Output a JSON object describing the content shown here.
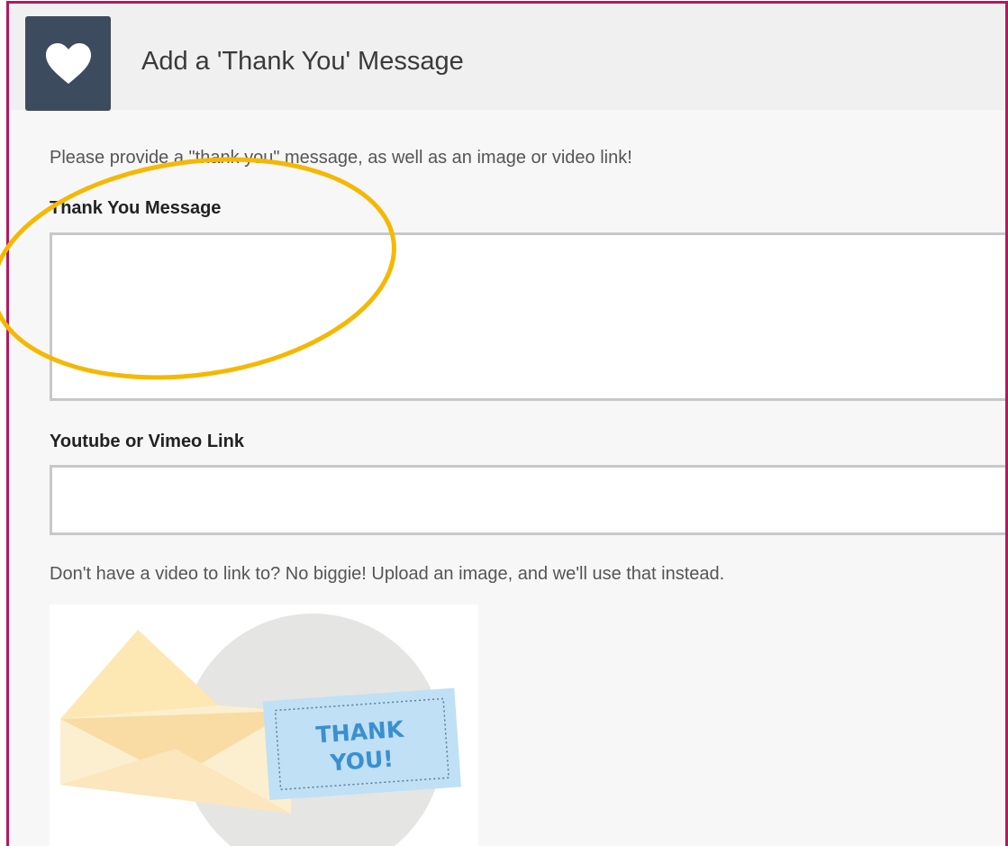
{
  "header": {
    "icon": "heart-icon",
    "title": "Add a 'Thank You' Message"
  },
  "intro_text": "Please provide a \"thank you\" message, as well as an image or video link!",
  "message_field": {
    "label": "Thank You Message",
    "value": "",
    "placeholder": ""
  },
  "link_field": {
    "label": "Youtube or Vimeo Link",
    "value": "",
    "placeholder": ""
  },
  "hint_text": "Don't have a video to link to? No biggie! Upload an image, and we'll use that instead.",
  "image": {
    "card_line1": "THANK",
    "card_line2": "YOU!",
    "icon": "envelope-icon"
  },
  "colors": {
    "frame_border": "#b5185f",
    "icon_box": "#3d4b5e",
    "highlight": "#f5b800",
    "card": "#bfe0f5",
    "card_text": "#3a8fd0"
  }
}
